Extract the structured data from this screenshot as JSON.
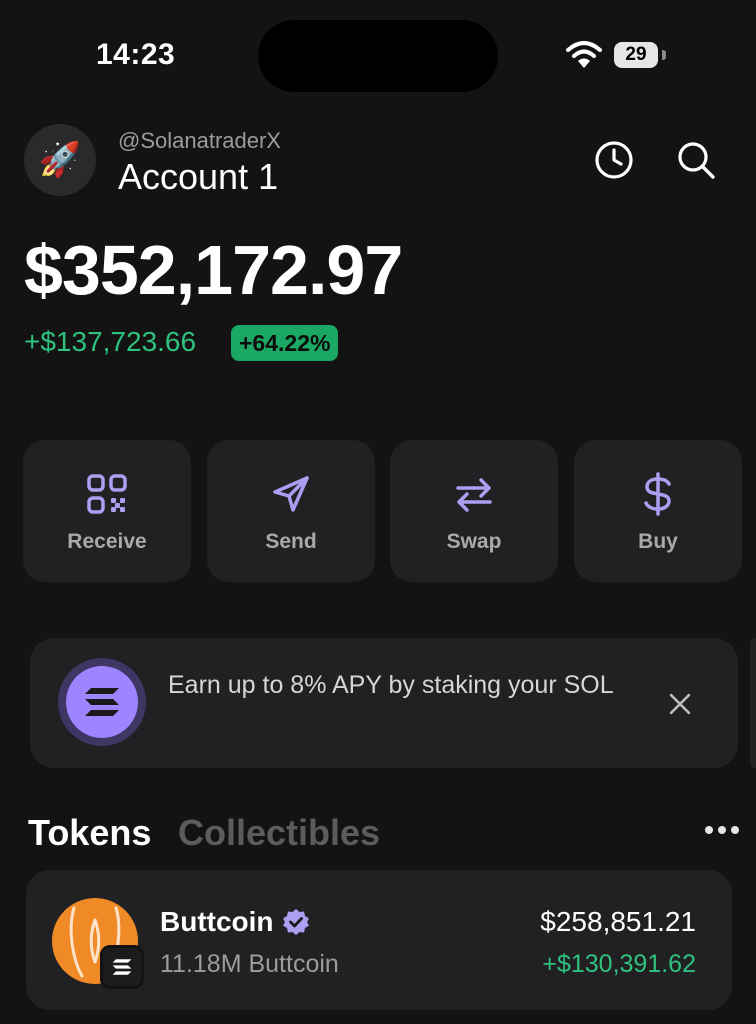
{
  "status_bar": {
    "time": "14:23",
    "battery": "29"
  },
  "header": {
    "avatar_emoji": "🚀",
    "handle": "@SolanatraderX",
    "account_name": "Account 1"
  },
  "balance": {
    "total": "$352,172.97",
    "change_value": "+$137,723.66",
    "change_percent": "+64.22%"
  },
  "actions": [
    {
      "label": "Receive",
      "icon": "qr-code-icon"
    },
    {
      "label": "Send",
      "icon": "send-icon"
    },
    {
      "label": "Swap",
      "icon": "swap-icon"
    },
    {
      "label": "Buy",
      "icon": "dollar-icon"
    }
  ],
  "banner": {
    "text": "Earn up to 8% APY by staking your SOL",
    "icon": "solana-icon"
  },
  "tabs": {
    "tokens": "Tokens",
    "collectibles": "Collectibles"
  },
  "tokens": [
    {
      "name": "Buttcoin",
      "amount": "11.18M Buttcoin",
      "value": "$258,851.21",
      "change": "+$130,391.62"
    }
  ],
  "colors": {
    "background": "#131313",
    "card": "#212123",
    "accent": "#ab9ff2",
    "positive": "#2ec27e"
  }
}
